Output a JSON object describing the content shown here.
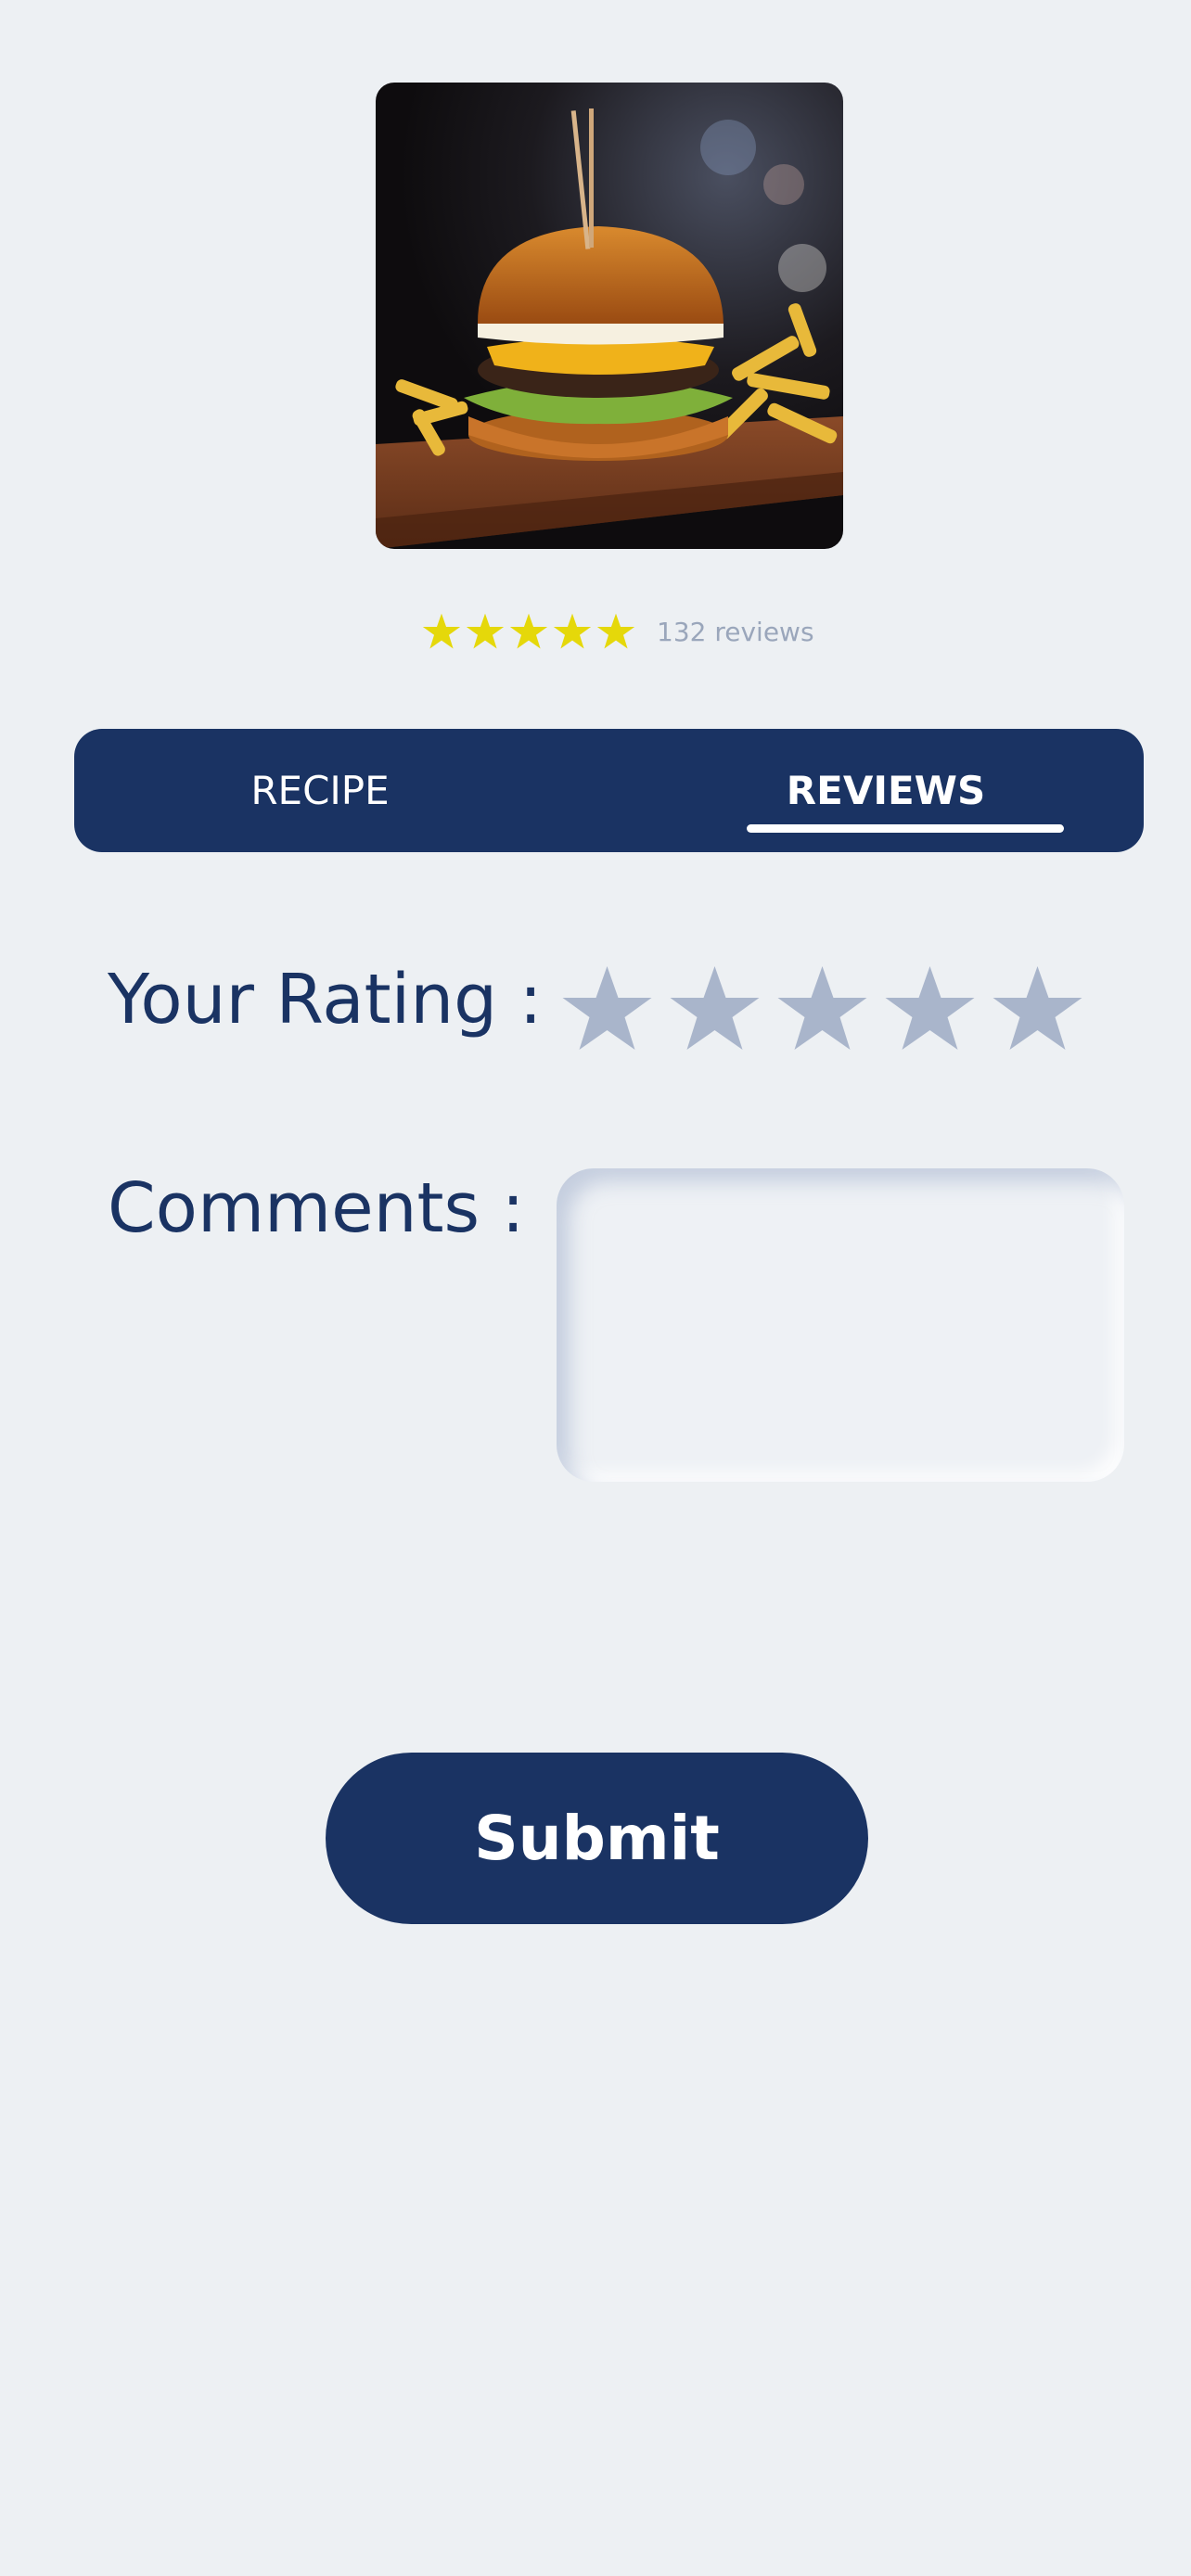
{
  "theme": {
    "background": "#edf0f3",
    "primary": "#1a3363",
    "star_filled": "#e5d80a",
    "star_empty": "#a9b5cb",
    "muted_text": "#9aa6bb"
  },
  "dish": {
    "image_icon": "burger-photo",
    "average_rating": 5,
    "max_rating": 5,
    "reviews_text": "132 reviews"
  },
  "tabs": [
    {
      "label": "RECIPE",
      "active": false
    },
    {
      "label": "REVIEWS",
      "active": true
    }
  ],
  "form": {
    "rating_label": "Your Rating :",
    "user_rating": 0,
    "rating_max": 5,
    "comments_label": "Comments :",
    "comments_value": "",
    "comments_placeholder": "",
    "submit_label": "Submit"
  }
}
